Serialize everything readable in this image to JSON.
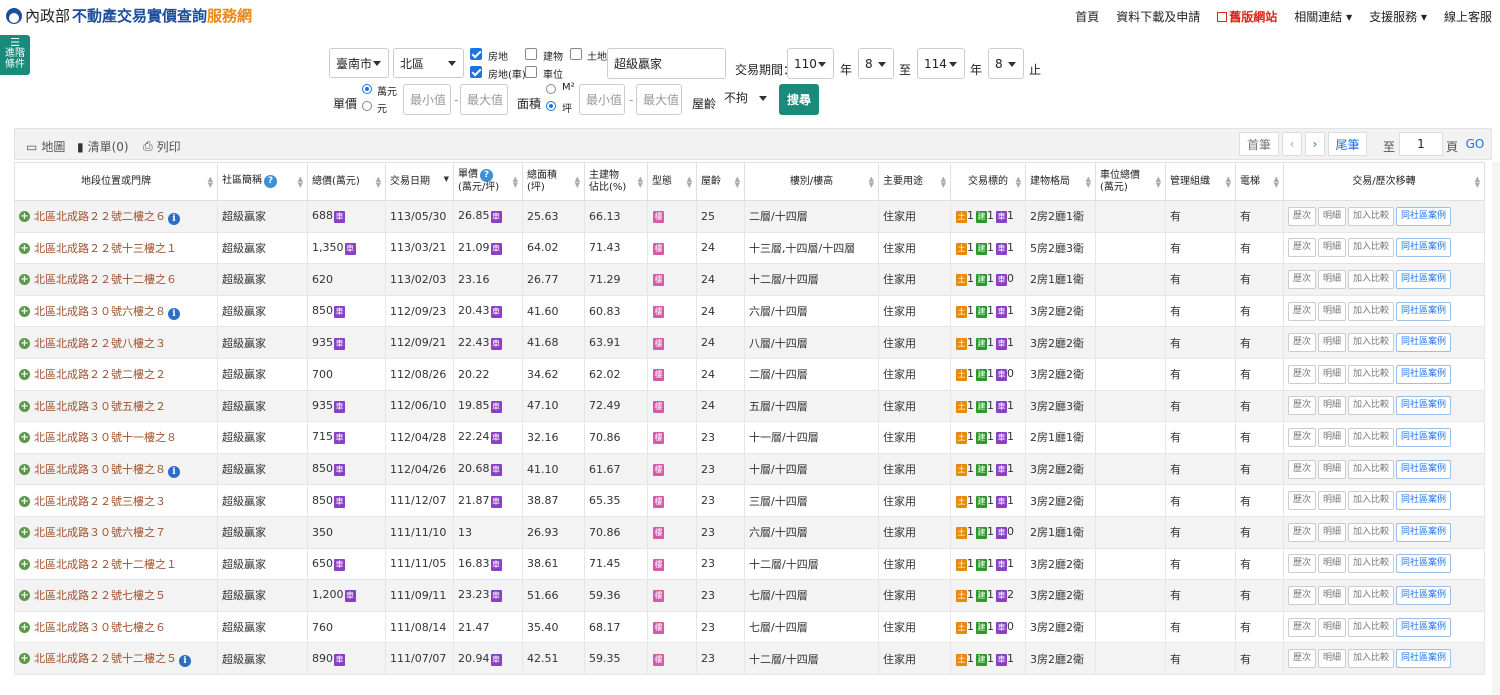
{
  "header": {
    "org": "內政部",
    "title_main": "不動產交易實價查詢",
    "title_accent": "服務網",
    "nav": [
      {
        "label": "首頁"
      },
      {
        "label": "資料下載及申請"
      },
      {
        "label": "舊版網站"
      },
      {
        "label": "相關連結 ▾"
      },
      {
        "label": "支援服務 ▾"
      },
      {
        "label": "線上客服"
      }
    ]
  },
  "left_tab": {
    "line1": "進階",
    "line2": "條件"
  },
  "filters": {
    "city": "臺南市",
    "district": "北區",
    "type_options": [
      {
        "label": "房地",
        "checked": true
      },
      {
        "label": "房地(車)",
        "checked": true
      },
      {
        "label": "建物",
        "checked": false
      },
      {
        "label": "車位",
        "checked": false
      },
      {
        "label": "土地",
        "checked": false
      }
    ],
    "keyword": "超級贏家",
    "period_label": "交易期間：",
    "from_year": "110",
    "year_unit": "年",
    "from_month": "8",
    "to_label": "至",
    "to_year": "114",
    "to_month": "8",
    "end_label": "止",
    "price_label": "單價",
    "price_unit_1": "萬元",
    "price_unit_2": "元",
    "min_placeholder": "最小值",
    "max_placeholder": "最大值",
    "dash": "-",
    "area_label": "面積",
    "area_unit_1": "M²",
    "area_unit_2": "坪",
    "age_label": "屋齡",
    "age_value": "不拘",
    "search_button": "搜尋"
  },
  "toolbar": {
    "map": "地圖",
    "list": "清單(0)",
    "print": "列印",
    "first": "首筆",
    "prev": "‹",
    "next": "›",
    "last": "尾筆",
    "to_label": "至",
    "page": "1",
    "page_unit": "頁",
    "go": "GO"
  },
  "table": {
    "headers": {
      "address": "地段位置或門牌",
      "community": "社區簡稱",
      "total_price": "總價(萬元)",
      "date": "交易日期",
      "unit_price_1": "單價",
      "unit_price_2": "(萬元/坪)",
      "total_area_1": "總面積",
      "total_area_2": "(坪)",
      "main_ratio_1": "主建物",
      "main_ratio_2": "佔比(%)",
      "type": "型態",
      "age": "屋齡",
      "floor": "樓別/樓高",
      "use": "主要用途",
      "target": "交易標的",
      "layout": "建物格局",
      "parking_price_1": "車位總價",
      "parking_price_2": "(萬元)",
      "mgmt": "管理組織",
      "elevator": "電梯",
      "actions": "交易/歷次移轉"
    },
    "badges": {
      "car": "車",
      "type": "樓",
      "land": "土",
      "building": "建",
      "car2": "車"
    },
    "actions": [
      "歷次",
      "明細",
      "加入比較",
      "同社區案例"
    ],
    "rows": [
      {
        "address": "北區北成路２２號二樓之６",
        "info": true,
        "community": "超級贏家",
        "total": "688",
        "car": true,
        "date": "113/05/30",
        "unit": "26.85",
        "ucar": true,
        "area": "25.63",
        "ratio": "66.13",
        "age": "25",
        "floor": "二層/十四層",
        "use": "住家用",
        "land": "1",
        "bld": "1",
        "park": "1",
        "layout": "2房2廳1衛",
        "pprice": "",
        "mgmt": "有",
        "elev": "有"
      },
      {
        "address": "北區北成路２２號十三樓之１",
        "info": false,
        "community": "超級贏家",
        "total": "1,350",
        "car": true,
        "date": "113/03/21",
        "unit": "21.09",
        "ucar": true,
        "area": "64.02",
        "ratio": "71.43",
        "age": "24",
        "floor": "十三層,十四層/十四層",
        "use": "住家用",
        "land": "1",
        "bld": "1",
        "park": "1",
        "layout": "5房2廳3衛",
        "pprice": "",
        "mgmt": "有",
        "elev": "有"
      },
      {
        "address": "北區北成路２２號十二樓之６",
        "info": false,
        "community": "超級贏家",
        "total": "620",
        "car": false,
        "date": "113/02/03",
        "unit": "23.16",
        "ucar": false,
        "area": "26.77",
        "ratio": "71.29",
        "age": "24",
        "floor": "十二層/十四層",
        "use": "住家用",
        "land": "1",
        "bld": "1",
        "park": "0",
        "layout": "2房1廳1衛",
        "pprice": "",
        "mgmt": "有",
        "elev": "有"
      },
      {
        "address": "北區北成路３０號六樓之８",
        "info": true,
        "community": "超級贏家",
        "total": "850",
        "car": true,
        "date": "112/09/23",
        "unit": "20.43",
        "ucar": true,
        "area": "41.60",
        "ratio": "60.83",
        "age": "24",
        "floor": "六層/十四層",
        "use": "住家用",
        "land": "1",
        "bld": "1",
        "park": "1",
        "layout": "3房2廳2衛",
        "pprice": "",
        "mgmt": "有",
        "elev": "有"
      },
      {
        "address": "北區北成路２２號八樓之３",
        "info": false,
        "community": "超級贏家",
        "total": "935",
        "car": true,
        "date": "112/09/21",
        "unit": "22.43",
        "ucar": true,
        "area": "41.68",
        "ratio": "63.91",
        "age": "24",
        "floor": "八層/十四層",
        "use": "住家用",
        "land": "1",
        "bld": "1",
        "park": "1",
        "layout": "3房2廳2衛",
        "pprice": "",
        "mgmt": "有",
        "elev": "有"
      },
      {
        "address": "北區北成路２２號二樓之２",
        "info": false,
        "community": "超級贏家",
        "total": "700",
        "car": false,
        "date": "112/08/26",
        "unit": "20.22",
        "ucar": false,
        "area": "34.62",
        "ratio": "62.02",
        "age": "24",
        "floor": "二層/十四層",
        "use": "住家用",
        "land": "1",
        "bld": "1",
        "park": "0",
        "layout": "3房2廳2衛",
        "pprice": "",
        "mgmt": "有",
        "elev": "有"
      },
      {
        "address": "北區北成路３０號五樓之２",
        "info": false,
        "community": "超級贏家",
        "total": "935",
        "car": true,
        "date": "112/06/10",
        "unit": "19.85",
        "ucar": true,
        "area": "47.10",
        "ratio": "72.49",
        "age": "24",
        "floor": "五層/十四層",
        "use": "住家用",
        "land": "1",
        "bld": "1",
        "park": "1",
        "layout": "3房2廳3衛",
        "pprice": "",
        "mgmt": "有",
        "elev": "有"
      },
      {
        "address": "北區北成路３０號十一樓之８",
        "info": false,
        "community": "超級贏家",
        "total": "715",
        "car": true,
        "date": "112/04/28",
        "unit": "22.24",
        "ucar": true,
        "area": "32.16",
        "ratio": "70.86",
        "age": "23",
        "floor": "十一層/十四層",
        "use": "住家用",
        "land": "1",
        "bld": "1",
        "park": "1",
        "layout": "2房1廳1衛",
        "pprice": "",
        "mgmt": "有",
        "elev": "有"
      },
      {
        "address": "北區北成路３０號十樓之８",
        "info": true,
        "community": "超級贏家",
        "total": "850",
        "car": true,
        "date": "112/04/26",
        "unit": "20.68",
        "ucar": true,
        "area": "41.10",
        "ratio": "61.67",
        "age": "23",
        "floor": "十層/十四層",
        "use": "住家用",
        "land": "1",
        "bld": "1",
        "park": "1",
        "layout": "3房2廳2衛",
        "pprice": "",
        "mgmt": "有",
        "elev": "有"
      },
      {
        "address": "北區北成路２２號三樓之３",
        "info": false,
        "community": "超級贏家",
        "total": "850",
        "car": true,
        "date": "111/12/07",
        "unit": "21.87",
        "ucar": true,
        "area": "38.87",
        "ratio": "65.35",
        "age": "23",
        "floor": "三層/十四層",
        "use": "住家用",
        "land": "1",
        "bld": "1",
        "park": "1",
        "layout": "3房2廳2衛",
        "pprice": "",
        "mgmt": "有",
        "elev": "有"
      },
      {
        "address": "北區北成路３０號六樓之７",
        "info": false,
        "community": "超級贏家",
        "total": "350",
        "car": false,
        "date": "111/11/10",
        "unit": "13",
        "ucar": false,
        "area": "26.93",
        "ratio": "70.86",
        "age": "23",
        "floor": "六層/十四層",
        "use": "住家用",
        "land": "1",
        "bld": "1",
        "park": "0",
        "layout": "2房1廳1衛",
        "pprice": "",
        "mgmt": "有",
        "elev": "有"
      },
      {
        "address": "北區北成路２２號十二樓之１",
        "info": false,
        "community": "超級贏家",
        "total": "650",
        "car": true,
        "date": "111/11/05",
        "unit": "16.83",
        "ucar": true,
        "area": "38.61",
        "ratio": "71.45",
        "age": "23",
        "floor": "十二層/十四層",
        "use": "住家用",
        "land": "1",
        "bld": "1",
        "park": "1",
        "layout": "3房2廳2衛",
        "pprice": "",
        "mgmt": "有",
        "elev": "有"
      },
      {
        "address": "北區北成路２２號七樓之５",
        "info": false,
        "community": "超級贏家",
        "total": "1,200",
        "car": true,
        "date": "111/09/11",
        "unit": "23.23",
        "ucar": true,
        "area": "51.66",
        "ratio": "59.36",
        "age": "23",
        "floor": "七層/十四層",
        "use": "住家用",
        "land": "1",
        "bld": "1",
        "park": "2",
        "layout": "3房2廳2衛",
        "pprice": "",
        "mgmt": "有",
        "elev": "有"
      },
      {
        "address": "北區北成路３０號七樓之６",
        "info": false,
        "community": "超級贏家",
        "total": "760",
        "car": false,
        "date": "111/08/14",
        "unit": "21.47",
        "ucar": false,
        "area": "35.40",
        "ratio": "68.17",
        "age": "23",
        "floor": "七層/十四層",
        "use": "住家用",
        "land": "1",
        "bld": "1",
        "park": "0",
        "layout": "3房2廳2衛",
        "pprice": "",
        "mgmt": "有",
        "elev": "有"
      },
      {
        "address": "北區北成路２２號十二樓之５",
        "info": true,
        "community": "超級贏家",
        "total": "890",
        "car": true,
        "date": "111/07/07",
        "unit": "20.94",
        "ucar": true,
        "area": "42.51",
        "ratio": "59.35",
        "age": "23",
        "floor": "十二層/十四層",
        "use": "住家用",
        "land": "1",
        "bld": "1",
        "park": "1",
        "layout": "3房2廳2衛",
        "pprice": "",
        "mgmt": "有",
        "elev": "有"
      }
    ]
  }
}
